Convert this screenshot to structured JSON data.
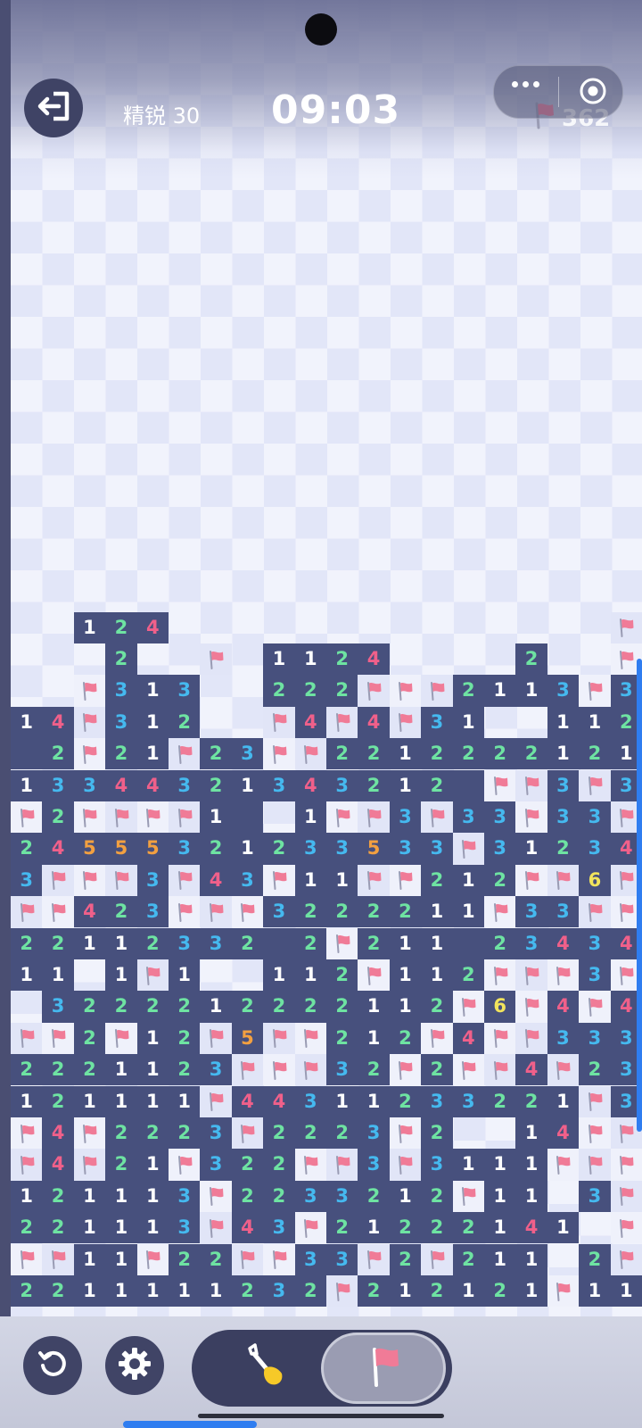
{
  "header": {
    "level_label": "精锐 30",
    "timer": "09:03",
    "flags_remaining": "362"
  },
  "icons": {
    "exit": "exit-icon",
    "menu": "more-dots-icon",
    "close": "close-circle-icon",
    "flag": "flag-icon",
    "restart": "restart-icon",
    "settings": "gear-icon",
    "dig": "shovel-icon"
  },
  "controls": {
    "active_mode": "flag"
  },
  "colors": {
    "revealed_cell": "#47507d",
    "flag": "#f07b97",
    "n1": "#ffffff",
    "n2": "#6ee3a2",
    "n3": "#45b9ef",
    "n4": "#f0608a",
    "n5": "#f3a040",
    "n6": "#f2e45c"
  },
  "board": {
    "columns": 20,
    "first_visible_row": 0,
    "legend": "digits = revealed count, F = flag, 0 = empty revealed, . = covered",
    "rows": [
      "..124..............F",
      "...2..F.1124....2..F5",
      "..F313..222FFF2113F3",
      "14F312..F4F4F31..112",
      "02F21F23FF2212222121",
      "133443213432120FF3F3F",
      "F2FFFF10.1FF3F33F33F4",
      "24555321233533F312343F",
      "3FFF3F43F11FF212FF6F",
      "FF423FFF3222211F33FF",
      "22112332 2F211 23434",
      "11.1F1..112F112FFF3F",
      ".3222212222112F6F4F4",
      "FF2F12F5FF212F4FF333",
      "2221123FFF32F2FF4F23",
      "121111F44311233221F3",
      "F4F2223F2223F2..14FF",
      "F4F21F322FF3F3111FFF",
      "121113F2233212F11.3F",
      "221113F43F21222141.F",
      "FF11F22FF33F2F211.2F",
      "2211111232F212121F11"
    ]
  }
}
